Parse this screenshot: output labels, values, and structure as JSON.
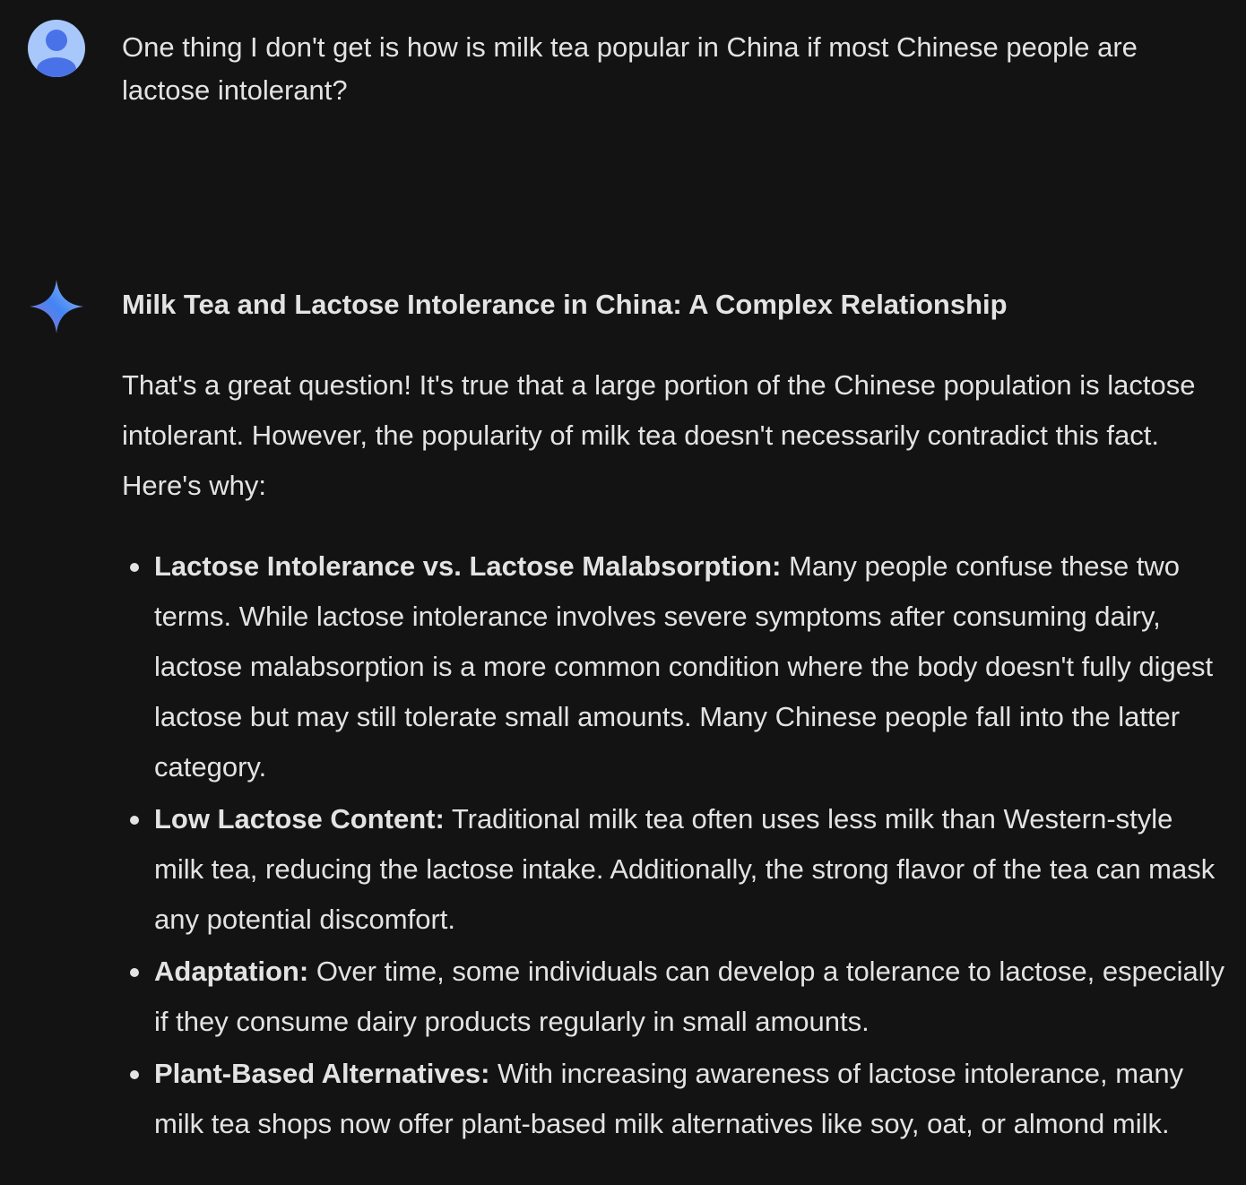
{
  "user": {
    "avatar_icon": "user-avatar-icon",
    "message": "One thing I don't get is how is milk tea popular in China if most Chinese people are lactose intolerant?"
  },
  "model": {
    "logo_icon": "gemini-sparkle-icon",
    "title": "Milk Tea and Lactose Intolerance in China: A Complex Relationship",
    "intro": "That's a great question! It's true that a large portion of the Chinese population is lactose intolerant. However, the popularity of milk tea doesn't necessarily contradict this fact. Here's why:",
    "bullets": [
      {
        "term": "Lactose Intolerance vs. Lactose Malabsorption:",
        "text": " Many people confuse these two terms. While lactose intolerance involves severe symptoms after consuming dairy, lactose malabsorption is a more common condition where the body doesn't fully digest lactose but may still tolerate small amounts. Many Chinese people fall into the latter category."
      },
      {
        "term": "Low Lactose Content:",
        "text": " Traditional milk tea often uses less milk than Western-style milk tea, reducing the lactose intake. Additionally, the strong flavor of the tea can mask any potential discomfort."
      },
      {
        "term": "Adaptation:",
        "text": " Over time, some individuals can develop a tolerance to lactose, especially if they consume dairy products regularly in small amounts."
      },
      {
        "term": "Plant-Based Alternatives:",
        "text": " With increasing awareness of lactose intolerance, many milk tea shops now offer plant-based milk alternatives like soy, oat, or almond milk."
      }
    ]
  },
  "colors": {
    "background": "#131314",
    "text": "#e3e3e3",
    "avatar_bg": "#a8c7fa",
    "avatar_fg": "#4a72e8"
  }
}
